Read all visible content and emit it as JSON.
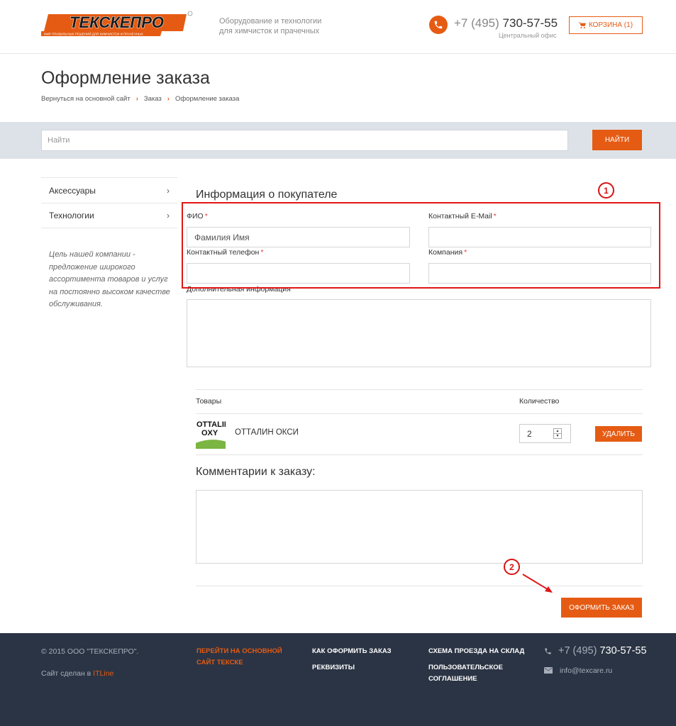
{
  "header": {
    "logo_text": "ТЕКСКЕПРО",
    "logo_subtext": "МИР ПРАВИЛЬНЫХ РЕШЕНИЙ ДЛЯ ХИМЧИСТОК И ПРАЧЕЧНЫХ",
    "tagline_line1": "Оборудование и технологии",
    "tagline_line2": "для химчисток и прачечных",
    "phone_code": "+7 (495)",
    "phone_number": "730-57-55",
    "phone_caption": "Центральный офис",
    "cart_label": "КОРЗИНА (1)"
  },
  "page": {
    "title": "Оформление заказа",
    "breadcrumb": [
      "Вернуться на основной сайт",
      "Заказ",
      "Оформление заказа"
    ]
  },
  "search": {
    "placeholder": "Найти",
    "button_label": "НАЙТИ"
  },
  "sidebar": {
    "items": [
      {
        "label": "Аксессуары"
      },
      {
        "label": "Технологии"
      }
    ],
    "description": "Цель нашей компании - предложение широкого ассортимента товаров и услуг на постоянно высоком качестве обслуживания."
  },
  "form": {
    "section_title": "Информация о покупателе",
    "fio_label": "ФИО",
    "fio_placeholder": "Фамилия Имя",
    "email_label": "Контактный E-Mail",
    "phone_label": "Контактный телефон",
    "company_label": "Компания",
    "extra_label": "Дополнительная информация",
    "required_mark": "*"
  },
  "products": {
    "col_goods": "Товары",
    "col_qty": "Количество",
    "rows": [
      {
        "logo_line1": "OTTALIN",
        "logo_line2": "OXY",
        "name": "ОТТАЛИН ОКСИ",
        "qty": "2",
        "delete_label": "УДАЛИТЬ"
      }
    ]
  },
  "comments": {
    "title": "Комментарии к заказу:"
  },
  "order_button": "ОФОРМИТЬ ЗАКАЗ",
  "annotations": {
    "marker1": "1",
    "marker2": "2",
    "accent_color": "#e01616"
  },
  "footer": {
    "copyright": "© 2015 ООО \"ТЕКСКЕПРО\".",
    "made_by_prefix": "Сайт сделан в",
    "made_by_link": "ITLine",
    "link_main_site_1": "ПЕРЕЙТИ НА ОСНОВНОЙ",
    "link_main_site_2": "САЙТ ТЕКСКЕ",
    "link_how_to_order": "КАК ОФОРМИТЬ ЗАКАЗ",
    "link_requisites": "РЕКВИЗИТЫ",
    "link_map": "СХЕМА ПРОЕЗДА НА СКЛАД",
    "link_agreement_1": "ПОЛЬЗОВАТЕЛЬСКОЕ",
    "link_agreement_2": "СОГЛАШЕНИЕ",
    "phone_code": "+7 (495)",
    "phone_number": "730-57-55",
    "email": "info@texcare.ru"
  },
  "colors": {
    "brand_orange": "#e55b13",
    "footer_bg": "#2b3444",
    "search_band": "#dde2e8"
  }
}
